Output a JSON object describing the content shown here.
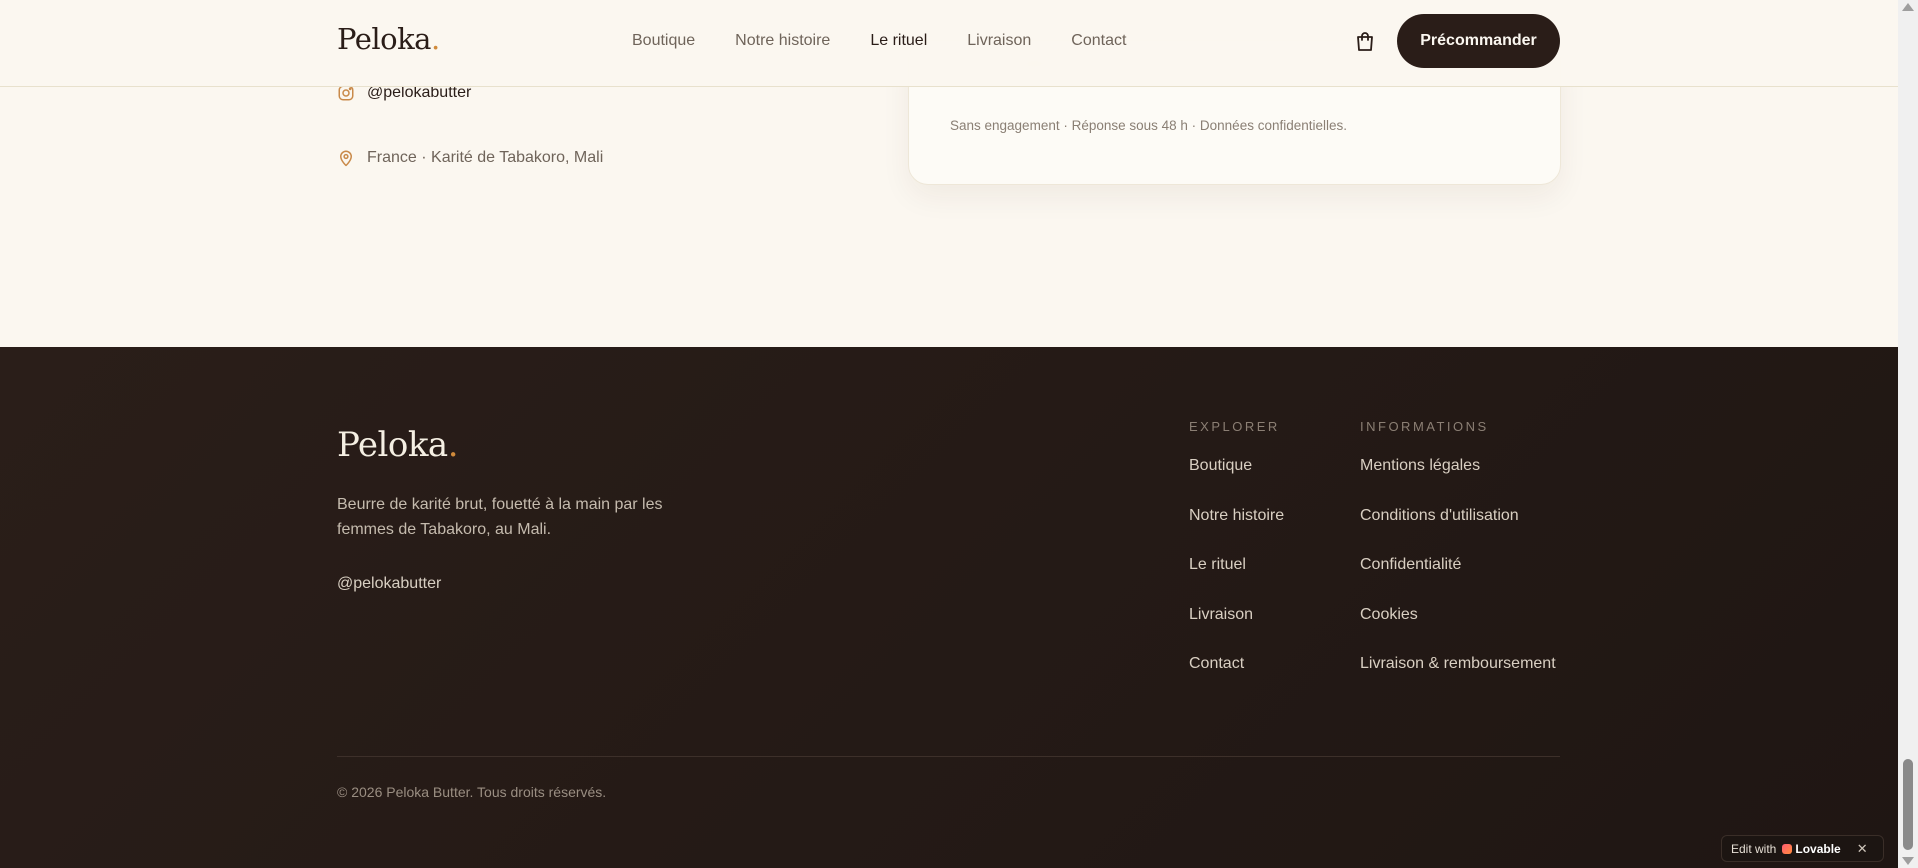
{
  "header": {
    "logo": "Peloka",
    "logo_dot": ".",
    "nav": [
      "Boutique",
      "Notre histoire",
      "Le rituel",
      "Livraison",
      "Contact"
    ],
    "active_nav": "Le rituel",
    "cart_icon": "shopping-bag-icon",
    "cta_label": "Précommander"
  },
  "contact": {
    "instagram_icon": "instagram-icon",
    "instagram_handle": "@pelokabutter",
    "location_icon": "map-pin-icon",
    "location": "France · Karité de Tabakoro, Mali",
    "form_note": "Sans engagement · Réponse sous 48 h · Données confidentielles."
  },
  "footer": {
    "logo": "Peloka",
    "logo_dot": ".",
    "description": "Beurre de karité brut, fouetté à la main par les femmes de Tabakoro, au Mali.",
    "handle": "@pelokabutter",
    "explorer": {
      "title": "EXPLORER",
      "links": [
        "Boutique",
        "Notre histoire",
        "Le rituel",
        "Livraison",
        "Contact"
      ]
    },
    "informations": {
      "title": "INFORMATIONS",
      "links": [
        "Mentions légales",
        "Conditions d'utilisation",
        "Confidentialité",
        "Cookies",
        "Livraison & remboursement"
      ]
    },
    "copyright": "© 2026 Peloka Butter. Tous droits réservés."
  },
  "lovable_badge": {
    "edit_label": "Edit with",
    "brand": "Lovable",
    "close_icon": "close-icon"
  },
  "colors": {
    "background": "#fbf7f0",
    "footer_background": "#231915",
    "accent": "#d08a3b",
    "cta_background": "#2a1d18"
  }
}
